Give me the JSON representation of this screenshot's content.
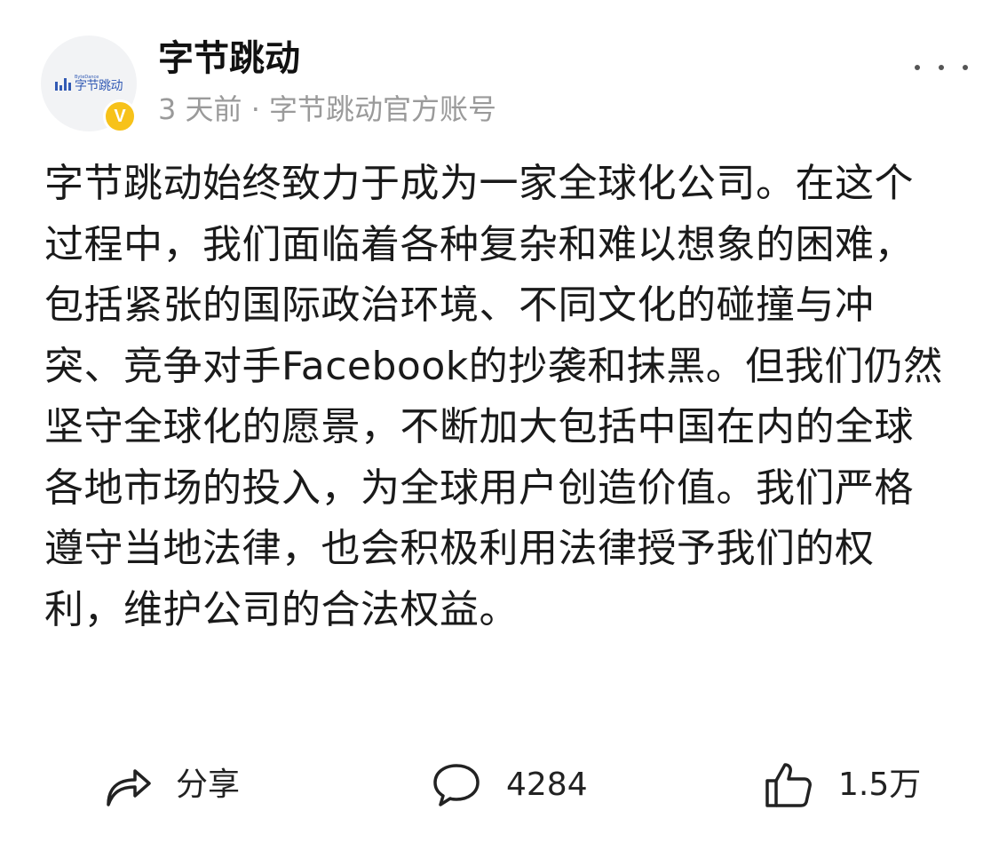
{
  "post": {
    "author": {
      "name": "字节跳动",
      "logo_en": "ByteDance",
      "logo_cn": "字节跳动",
      "verified_mark": "V",
      "verified_color": "#f7c21a"
    },
    "meta": "3 天前 · 字节跳动官方账号",
    "content": "字节跳动始终致力于成为一家全球化公司。在这个过程中，我们面临着各种复杂和难以想象的困难，包括紧张的国际政治环境、不同文化的碰撞与冲突、竞争对手Facebook的抄袭和抹黑。但我们仍然坚守全球化的愿景，不断加大包括中国在内的全球各地市场的投入，为全球用户创造价值。我们严格遵守当地法律，也会积极利用法律授予我们的权利，维护公司的合法权益。",
    "more_icon": "more-horizontal-icon"
  },
  "actions": {
    "share": {
      "icon": "share-arrow-icon",
      "label": "分享"
    },
    "comment": {
      "icon": "comment-bubble-icon",
      "count": "4284"
    },
    "like": {
      "icon": "thumbs-up-icon",
      "count": "1.5万"
    }
  }
}
